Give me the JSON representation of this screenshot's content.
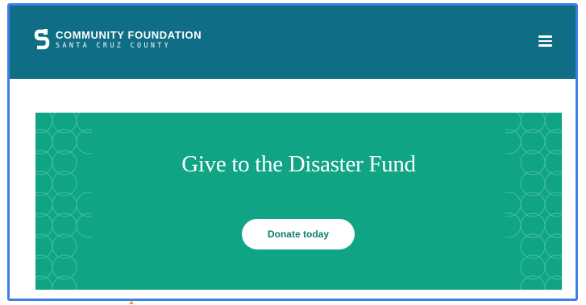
{
  "header": {
    "logo_line1": "COMMUNITY FOUNDATION",
    "logo_line2": "SANTA CRUZ COUNTY",
    "menu_icon": "hamburger-menu-icon"
  },
  "banner": {
    "title": "Give to the Disaster Fund",
    "button_label": "Donate today"
  },
  "colors": {
    "header_bg": "#0f6d85",
    "banner_bg": "#0fa584",
    "frame_border": "#3f7ee6"
  }
}
